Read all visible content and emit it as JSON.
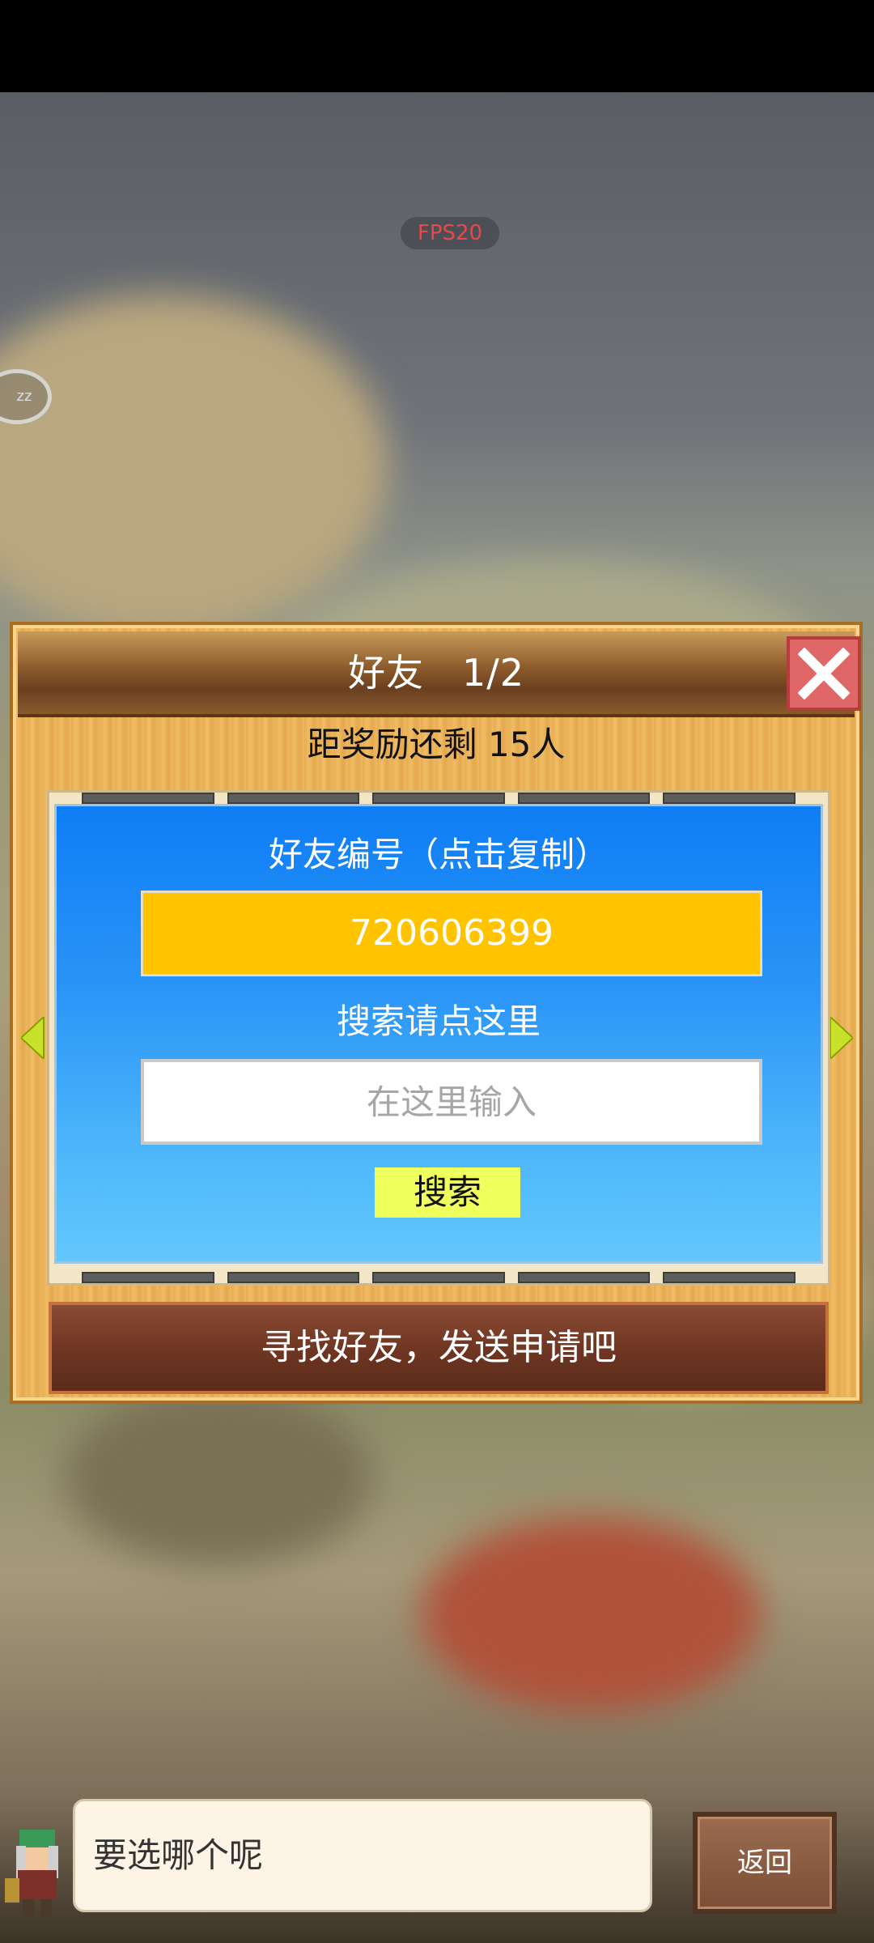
{
  "overlay": {
    "fps": "FPS20",
    "sleep_label": "zz"
  },
  "dialog": {
    "title": "好友　1/2",
    "reward_text": "距奖励还剩 15人",
    "friend_id_label": "好友编号（点击复制）",
    "friend_id": "720606399",
    "search_label": "搜索请点这里",
    "search_placeholder": "在这里输入",
    "search_button": "搜索",
    "find_friends_button": "寻找好友，发送申请吧",
    "tab_count": 5
  },
  "footer": {
    "speech_text": "要选哪个呢",
    "back_button": "返回"
  },
  "colors": {
    "friend_id_bg": "#ffc300",
    "search_button_bg": "#efff5d",
    "close_button_bg": "#e06767",
    "panel_blue": "#0e7df5"
  }
}
